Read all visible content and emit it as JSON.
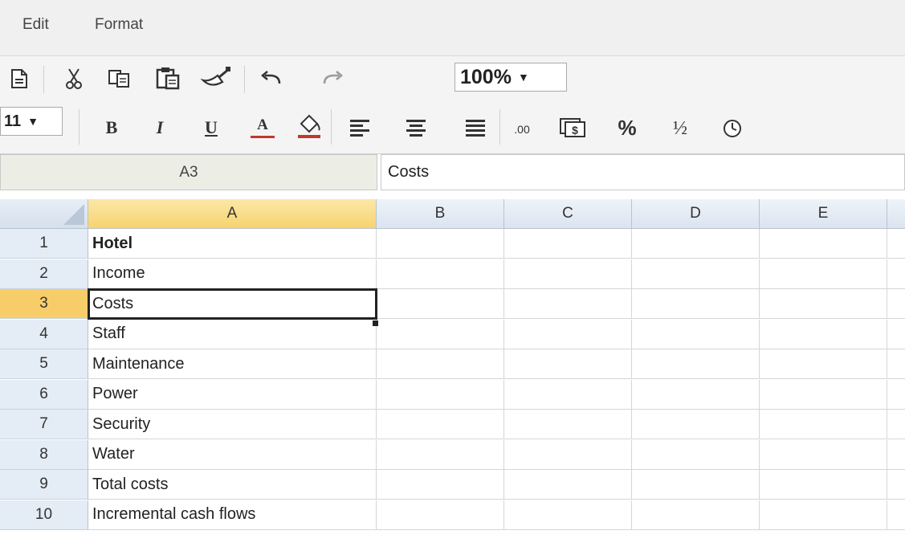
{
  "menu": {
    "items": [
      "Edit",
      "Format"
    ]
  },
  "toolbar": {
    "zoom": "100%",
    "font_size": "11",
    "caret": "▼",
    "icons": [
      "new-document-icon",
      "cut-icon",
      "copy-icon",
      "paste-icon",
      "format-painter-icon",
      "undo-icon",
      "redo-icon",
      "bold-icon",
      "italic-icon",
      "underline-icon",
      "font-color-icon",
      "fill-color-icon",
      "align-left-icon",
      "align-center-icon",
      "align-right-icon",
      "decimal-icon",
      "currency-icon",
      "percent-icon",
      "fraction-icon",
      "time-icon"
    ],
    "glyphs": {
      "bold": "B",
      "italic": "I",
      "underline": "U",
      "font_color": "A",
      "decimal": ".00",
      "percent": "%",
      "fraction": "½"
    }
  },
  "formula_bar": {
    "cell_ref": "A3",
    "content": "Costs"
  },
  "grid": {
    "columns": [
      "A",
      "B",
      "C",
      "D",
      "E"
    ],
    "active_column": "A",
    "active_row": 3,
    "rows": [
      {
        "num": "1",
        "a": "Hotel",
        "bold": true
      },
      {
        "num": "2",
        "a": "Income"
      },
      {
        "num": "3",
        "a": "Costs"
      },
      {
        "num": "4",
        "a": "Staff"
      },
      {
        "num": "5",
        "a": "Maintenance"
      },
      {
        "num": "6",
        "a": "Power"
      },
      {
        "num": "7",
        "a": "Security"
      },
      {
        "num": "8",
        "a": "Water"
      },
      {
        "num": "9",
        "a": "Total costs"
      },
      {
        "num": "10",
        "a": "Incremental cash flows"
      }
    ]
  },
  "colors": {
    "selected_header": "#f6d36d",
    "header_bg": "#dbe4ef",
    "selection_border": "#222222"
  }
}
